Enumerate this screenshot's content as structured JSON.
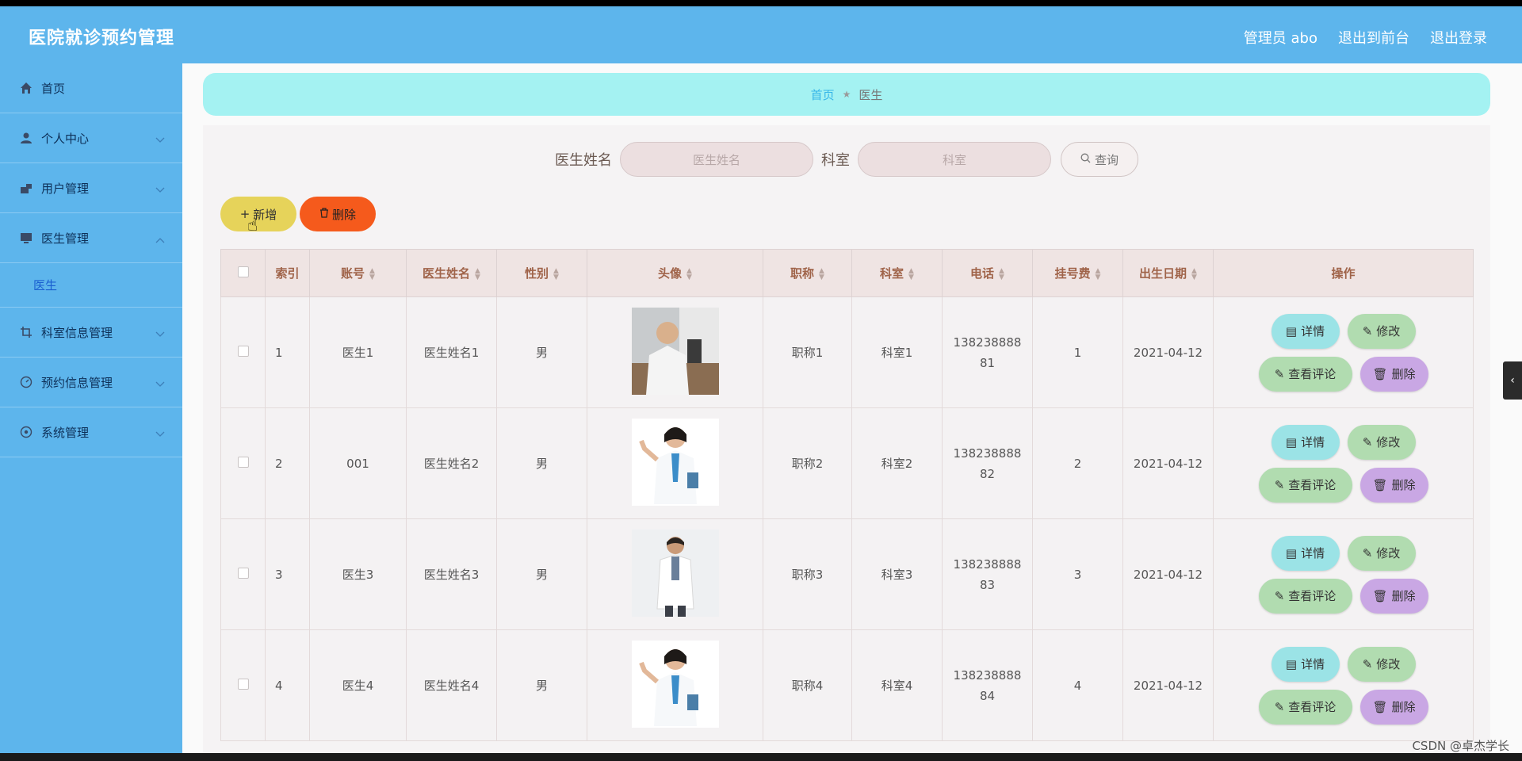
{
  "app": {
    "title": "医院就诊预约管理"
  },
  "header": {
    "user_label": "管理员 abo",
    "to_front": "退出到前台",
    "logout": "退出登录"
  },
  "sidebar": {
    "items": [
      {
        "label": "首页",
        "icon": "home-icon"
      },
      {
        "label": "个人中心",
        "icon": "user-icon"
      },
      {
        "label": "用户管理",
        "icon": "users-icon"
      },
      {
        "label": "医生管理",
        "icon": "monitor-icon"
      },
      {
        "label": "科室信息管理",
        "icon": "crop-icon"
      },
      {
        "label": "预约信息管理",
        "icon": "gauge-icon"
      },
      {
        "label": "系统管理",
        "icon": "settings-icon"
      }
    ],
    "sub_item": "医生"
  },
  "breadcrumb": {
    "home": "首页",
    "current": "医生"
  },
  "search": {
    "name_label": "医生姓名",
    "name_placeholder": "医生姓名",
    "dept_label": "科室",
    "dept_placeholder": "科室",
    "query": "查询"
  },
  "actions": {
    "add": "新增",
    "delete": "删除"
  },
  "table": {
    "headers": [
      "索引",
      "账号",
      "医生姓名",
      "性别",
      "头像",
      "职称",
      "科室",
      "电话",
      "挂号费",
      "出生日期",
      "操作"
    ],
    "rows": [
      {
        "index": "1",
        "account": "医生1",
        "name": "医生姓名1",
        "gender": "男",
        "title": "职称1",
        "dept": "科室1",
        "phone1": "138238888",
        "phone2": "81",
        "fee": "1",
        "birth": "2021-04-12"
      },
      {
        "index": "2",
        "account": "001",
        "name": "医生姓名2",
        "gender": "男",
        "title": "职称2",
        "dept": "科室2",
        "phone1": "138238888",
        "phone2": "82",
        "fee": "2",
        "birth": "2021-04-12"
      },
      {
        "index": "3",
        "account": "医生3",
        "name": "医生姓名3",
        "gender": "男",
        "title": "职称3",
        "dept": "科室3",
        "phone1": "138238888",
        "phone2": "83",
        "fee": "3",
        "birth": "2021-04-12"
      },
      {
        "index": "4",
        "account": "医生4",
        "name": "医生姓名4",
        "gender": "男",
        "title": "职称4",
        "dept": "科室4",
        "phone1": "138238888",
        "phone2": "84",
        "fee": "4",
        "birth": "2021-04-12"
      }
    ],
    "ops": {
      "detail": "详情",
      "edit": "修改",
      "review": "查看评论",
      "delete": "删除"
    }
  },
  "watermark": "CSDN @卓杰学长"
}
